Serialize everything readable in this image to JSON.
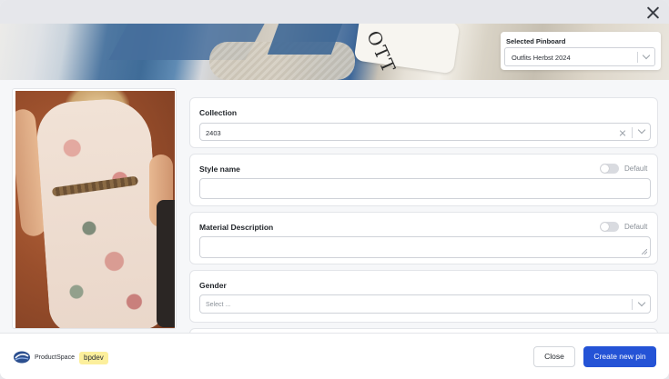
{
  "pinboard": {
    "label": "Selected Pinboard",
    "value": "Outfits Herbst 2024"
  },
  "banner": {
    "cup_text": "OTT"
  },
  "form": {
    "collection": {
      "label": "Collection",
      "value": "2403"
    },
    "style_name": {
      "label": "Style name",
      "value": "",
      "toggle_label": "Default",
      "toggle_on": false
    },
    "material_description": {
      "label": "Material Description",
      "value": "",
      "toggle_label": "Default",
      "toggle_on": false
    },
    "gender": {
      "label": "Gender",
      "placeholder": "Select ..."
    }
  },
  "footer": {
    "brand": "ProductSpace",
    "env_badge": "bpdev",
    "close_label": "Close",
    "create_label": "Create new pin"
  },
  "icons": [
    "close-icon",
    "chevron-down-icon",
    "clear-icon",
    "productspace-logo-icon",
    "resize-grip-icon"
  ],
  "colors": {
    "primary": "#2453d6",
    "badge": "#fcef9c",
    "background": "#f6f7f9"
  }
}
